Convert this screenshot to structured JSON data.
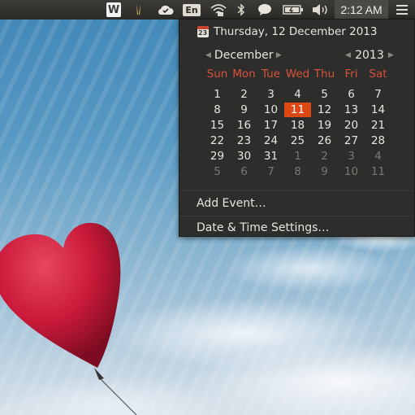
{
  "panel": {
    "icons": [
      "writer-icon",
      "pencil-icon",
      "cloud-icon",
      "keyboard-icon",
      "wifi-icon",
      "bluetooth-icon",
      "chat-icon",
      "battery-icon",
      "volume-icon",
      "menu-icon"
    ],
    "keyboard_label": "En",
    "writer_label": "W",
    "clock": "2:12 AM"
  },
  "calendar": {
    "date_line": "Thursday, 12 December 2013",
    "cal_icon_text": "23",
    "month": "December",
    "year": "2013",
    "weekdays": [
      "Sun",
      "Mon",
      "Tue",
      "Wed",
      "Thu",
      "Fri",
      "Sat"
    ],
    "weeks": [
      [
        "1",
        "2",
        "3",
        "4",
        "5",
        "6",
        "7"
      ],
      [
        "8",
        "9",
        "10",
        "11",
        "12",
        "13",
        "14"
      ],
      [
        "15",
        "16",
        "17",
        "18",
        "19",
        "20",
        "21"
      ],
      [
        "22",
        "23",
        "24",
        "25",
        "26",
        "27",
        "28"
      ],
      [
        "29",
        "30",
        "31",
        "1",
        "2",
        "3",
        "4"
      ],
      [
        "5",
        "6",
        "7",
        "8",
        "9",
        "10",
        "11"
      ]
    ],
    "today": "11",
    "accent_color": "#dd4814",
    "weekday_color": "#d9533a"
  },
  "menu": {
    "add_event": "Add Event…",
    "settings": "Date & Time Settings…"
  }
}
